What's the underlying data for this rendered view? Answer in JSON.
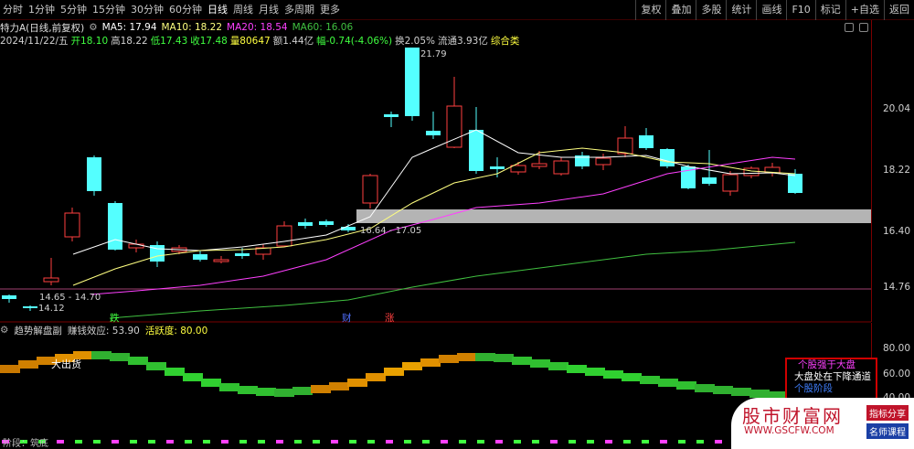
{
  "toolbar": {
    "left_items": [
      "分时",
      "1分钟",
      "5分钟",
      "15分钟",
      "30分钟",
      "60分钟",
      "日线",
      "周线",
      "月线",
      "多周期",
      "更多"
    ],
    "active_item": "日线",
    "right_items": [
      "复权",
      "叠加",
      "多股",
      "统计",
      "画线",
      "F10",
      "标记",
      "+自选",
      "返回"
    ]
  },
  "stock": {
    "title": "特力A(日线,前复权)",
    "ma5": "MA5: 17.94",
    "ma10": "MA10: 18.22",
    "ma20": "MA20: 18.54",
    "ma60": "MA60: 16.06",
    "date": "2024/11/22/五",
    "open": "开18.10",
    "high": "高18.22",
    "low": "低17.43",
    "close": "收17.48",
    "volume": "量80647",
    "amount": "额1.44亿",
    "change": "幅-0.74(-4.06%)",
    "turnover": "换2.05%",
    "float_cap": "流通3.93亿",
    "category": "综合类"
  },
  "price_axis": [
    "20.04",
    "18.22",
    "16.40",
    "14.76"
  ],
  "annotations": {
    "high": "21.79",
    "gap": "16.64 - 17.05",
    "low_range": "14.65 - 14.70",
    "low": "14.12"
  },
  "event_markers": {
    "fall": "跌",
    "finance": "财",
    "rise": "涨"
  },
  "indicator": {
    "name": "趋势解盘副",
    "profit_effect": "赚钱效应: 53.90",
    "activity": "活跃度: 80.00",
    "label_exit": "大出货",
    "axis": [
      "80.00",
      "60.00",
      "40.00"
    ],
    "legend": [
      "个股强于大盘",
      "大盘处在下降通道",
      "个股阶段"
    ],
    "bottom_text": "阶段：筑底"
  },
  "brand": {
    "name": "股市财富网",
    "url": "WWW.GSCFW.COM",
    "tag1": "指标分享",
    "tag2": "名师课程"
  },
  "colors": {
    "up": "#ff4040",
    "down": "#54ffff",
    "ma5": "#ffffff",
    "ma10": "#ffff80",
    "ma20": "#ff40ff",
    "ma60": "#40c040"
  }
}
